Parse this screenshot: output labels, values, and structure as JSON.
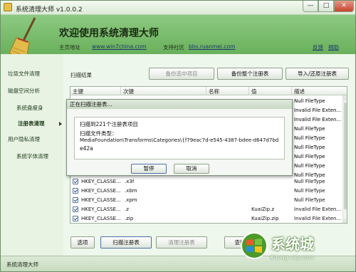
{
  "window": {
    "title": "系统清理大师 v1.0.0.2",
    "controls": {
      "minimize": "—",
      "maximize": "□",
      "close": "✕"
    }
  },
  "header": {
    "welcome": "欢迎使用系统清理大师",
    "homepage_label": "主页地址",
    "homepage_url": "www.win7china.com",
    "support_label": "支持社区",
    "support_url": "bbs.ruanmei.com",
    "feedback_link": "反馈",
    "donate_link": "捐助"
  },
  "sidebar": {
    "items": [
      {
        "label": "垃圾文件清理"
      },
      {
        "label": "磁盘空间分析"
      },
      {
        "label": "系统盘瘦身"
      },
      {
        "label": "注册表清理"
      },
      {
        "label": "用户隐私清理"
      },
      {
        "label": "系统字体清理"
      }
    ]
  },
  "main": {
    "scan_result_label": "扫描结果",
    "toolbar": {
      "backup_selected": "备份选中项目",
      "backup_all": "备份整个注册表",
      "import_restore": "导入/还原注册表"
    },
    "table": {
      "columns": [
        "主键",
        "次键",
        "名称",
        "值",
        "描述"
      ],
      "rows": [
        {
          "key": "HKEY_CLASSE...",
          "subkey": ".x3f",
          "name": "",
          "value": "",
          "desc": "Null FileType"
        },
        {
          "key": "HKEY_CLASSE...",
          "subkey": ".xbm",
          "name": "",
          "value": "",
          "desc": "Null FileType"
        },
        {
          "key": "HKEY_CLASSE...",
          "subkey": ".xpm",
          "name": "",
          "value": "",
          "desc": "Null FileType"
        },
        {
          "key": "HKEY_CLASSE...",
          "subkey": ".z",
          "name": "",
          "value": "KuaiZip.z",
          "desc": "Invalid File Exten..."
        },
        {
          "key": "HKEY_CLASSE...",
          "subkey": ".zip",
          "name": "",
          "value": "KuaiZip.zip",
          "desc": "Invalid File Exten..."
        }
      ],
      "hidden_desc_rows": [
        "Null FileType",
        "Invalid File Exten...",
        "Invalid File Exten...",
        "Null FileType",
        "Null FileType",
        "Null FileType",
        "Null FileType",
        "Null FileType",
        "Null FileType",
        "Null FileType",
        "Null FileType",
        "Null FileType"
      ]
    },
    "bottom_buttons": {
      "options": "选项",
      "scan_registry": "扫描注册表",
      "clean_registry": "清理注册表",
      "find": "查找"
    }
  },
  "dialog": {
    "title": "正在扫描注册表...",
    "line1": "扫描到221个注册表项目",
    "line2": "扫描文件类型：",
    "line3": "MediaFoundation\\Transforms\\Categories\\{f79eac7d-e545-4387-bdee-d647d7bd",
    "line4": "e42a",
    "pause": "暂停",
    "cancel": "取消"
  },
  "statusbar": {
    "text": "系统清理大师"
  },
  "watermark": {
    "brand": "系统城",
    "url": "Xitong city.com"
  }
}
